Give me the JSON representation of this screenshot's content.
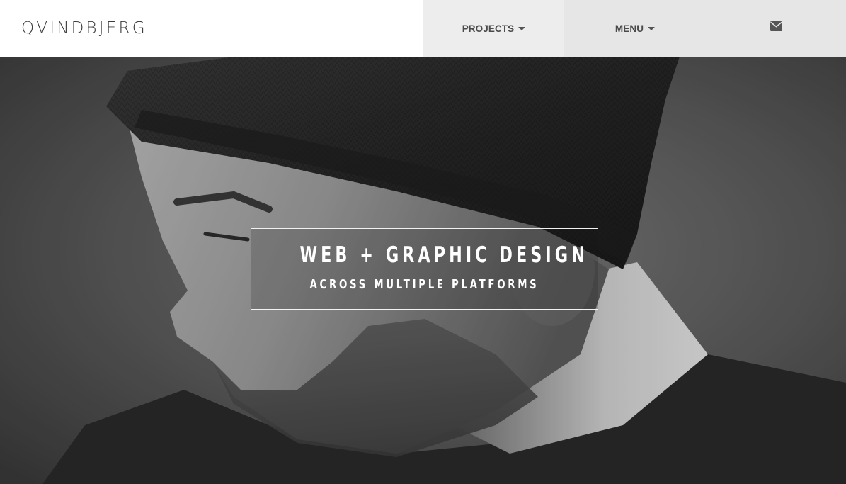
{
  "header": {
    "logo": "QVINDBJERG",
    "nav": {
      "projects_label": "PROJECTS",
      "menu_label": "MENU",
      "contact_icon": "envelope-icon"
    }
  },
  "hero": {
    "headline": "WEB + GRAPHIC DESIGN",
    "subheadline": "ACROSS MULTIPLE PLATFORMS"
  },
  "colors": {
    "header_bg": "#ffffff",
    "nav_bg": "#e6e6e6",
    "nav_text": "#4a4a4a",
    "hero_text": "#ffffff"
  }
}
